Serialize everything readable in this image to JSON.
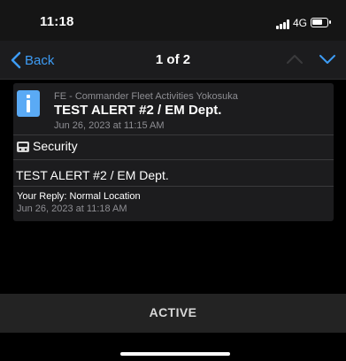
{
  "status_bar": {
    "time": "11:18",
    "network": "4G"
  },
  "nav": {
    "back_label": "Back",
    "title": "1 of 2",
    "accent_color": "#3d9cf5"
  },
  "alert": {
    "sender": "FE - Commander Fleet Activities Yokosuka",
    "title": "TEST ALERT #2 / EM Dept.",
    "timestamp": "Jun 26, 2023 at 11:15 AM",
    "category": "Security",
    "body": "TEST ALERT #2 / EM Dept.",
    "reply": "Your Reply: Normal Location",
    "reply_timestamp": "Jun 26, 2023 at 11:18 AM",
    "icon": "info-icon",
    "category_icon": "security-icon"
  },
  "footer": {
    "status_label": "ACTIVE"
  }
}
